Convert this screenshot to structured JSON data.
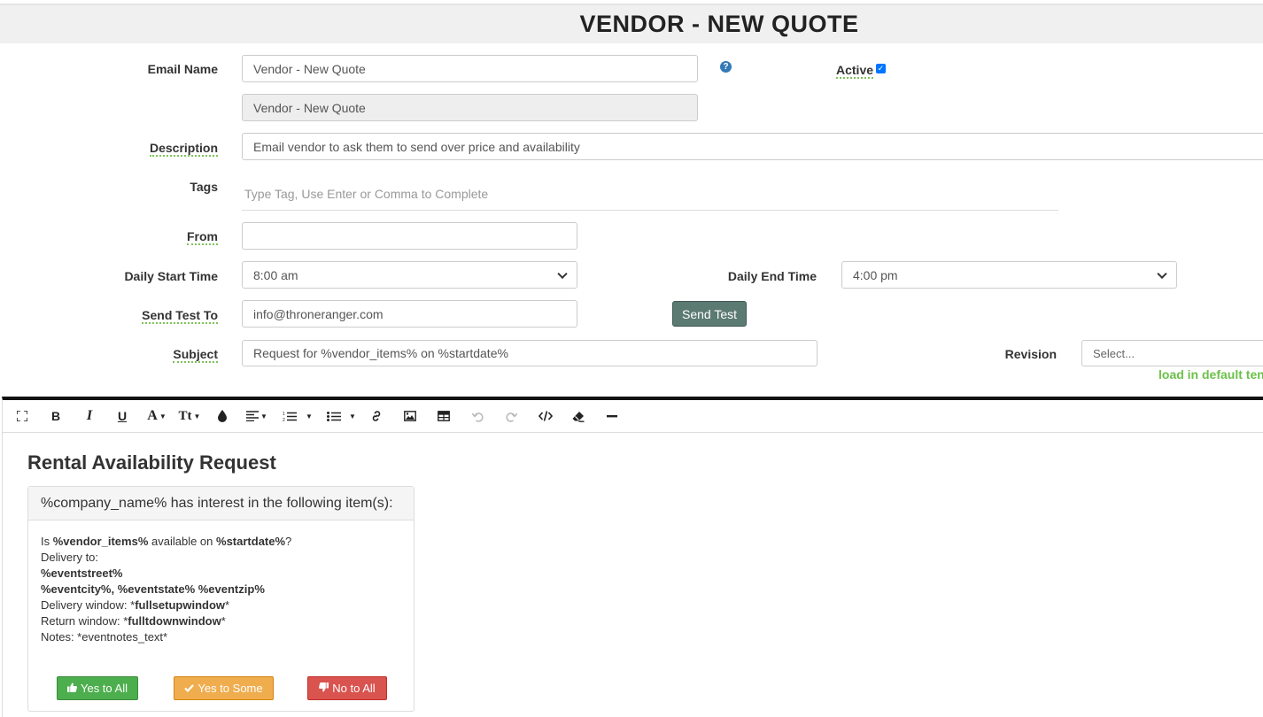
{
  "header": {
    "title": "VENDOR - NEW QUOTE"
  },
  "form": {
    "email_name": {
      "label": "Email Name",
      "value": "Vendor - New Quote",
      "readonly_value": "Vendor - New Quote"
    },
    "active": {
      "label": "Active",
      "checked": true
    },
    "description": {
      "label": "Description",
      "value": "Email vendor to ask them to send over price and availability"
    },
    "tags": {
      "label": "Tags",
      "placeholder": "Type Tag, Use Enter or Comma to Complete"
    },
    "from": {
      "label": "From",
      "value": ""
    },
    "daily_start_time": {
      "label": "Daily Start Time",
      "value": "8:00 am"
    },
    "daily_end_time": {
      "label": "Daily End Time",
      "value": "4:00 pm"
    },
    "send_test_to": {
      "label": "Send Test To",
      "value": "info@throneranger.com",
      "button": "Send Test"
    },
    "subject": {
      "label": "Subject",
      "value": "Request for %vendor_items% on %startdate%"
    },
    "revision": {
      "label": "Revision",
      "value": "Select...",
      "link": "load in default ten"
    }
  },
  "toolbar": {
    "icons": [
      "fullscreen-icon",
      "bold-icon",
      "italic-icon",
      "underline-icon",
      "font-color-icon",
      "font-size-icon",
      "color-drop-icon",
      "align-icon",
      "ordered-list-icon",
      "unordered-list-icon",
      "link-icon",
      "image-icon",
      "table-icon",
      "undo-icon",
      "redo-icon",
      "code-view-icon",
      "eraser-icon",
      "horizontal-rule-icon"
    ]
  },
  "editor": {
    "heading": "Rental Availability Request",
    "panel_title": "%company_name% has interest in the following item(s):",
    "line1_pre": "Is ",
    "line1_b1": "%vendor_items%",
    "line1_mid": " available on ",
    "line1_b2": "%startdate%",
    "line1_post": "?",
    "line2": "Delivery to:",
    "line3": "%eventstreet%",
    "line4": "%eventcity%, %eventstate% %eventzip%",
    "line5_pre": "Delivery window: *",
    "line5_b": "fullsetupwindow",
    "line5_post": "*",
    "line6_pre": "Return window: *",
    "line6_b": "fulltdownwindow",
    "line6_post": "*",
    "line7": "Notes: *eventnotes_text*",
    "buttons": {
      "yes_all": "Yes to All",
      "yes_some": "Yes to Some",
      "no_all": "No to All"
    }
  },
  "colors": {
    "yes_all": "#4cae4c",
    "yes_some": "#f0ad4e",
    "no_all": "#d9534f",
    "send_test": "#5b7a72",
    "link_green": "#6cc04a"
  }
}
